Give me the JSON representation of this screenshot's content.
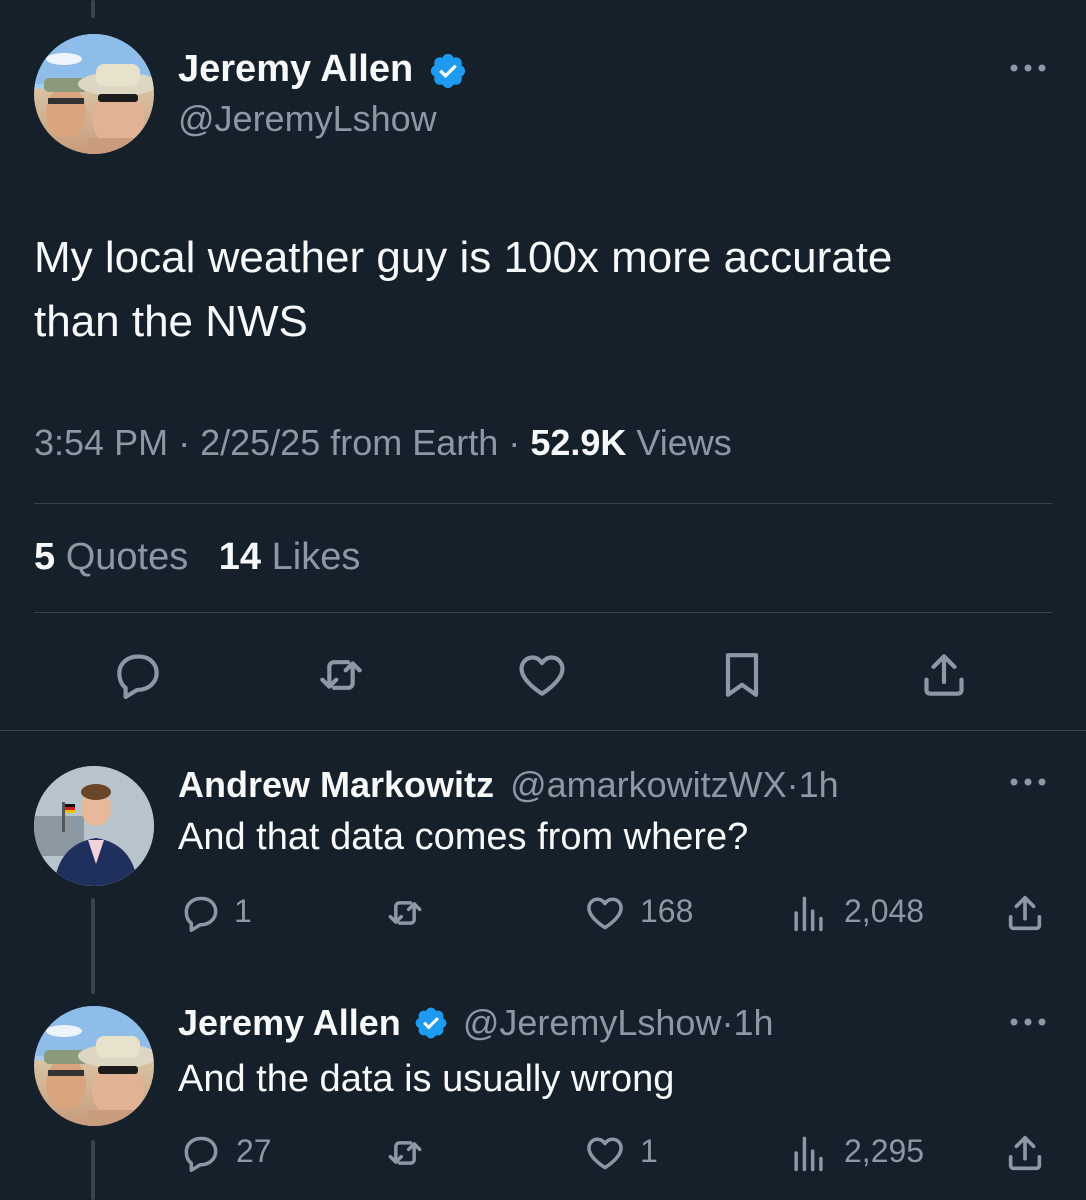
{
  "main_tweet": {
    "author_name": "Jeremy Allen",
    "handle": "@JeremyLshow",
    "text_line1": "My local weather guy is 100x more accurate",
    "text_line2": "than the NWS",
    "time": "3:54 PM",
    "date": "2/25/25 from Earth",
    "views_count": "52.9K",
    "views_label": "Views",
    "quotes_count": "5",
    "quotes_label": "Quotes",
    "likes_count": "14",
    "likes_label": "Likes"
  },
  "replies": [
    {
      "author_name": "Andrew Markowitz",
      "handle": "@amarkowitzWX",
      "time_ago": "1h",
      "text": "And that data comes from where?",
      "reply_count": "1",
      "retweet_count": "",
      "like_count": "168",
      "view_count": "2,048"
    },
    {
      "author_name": "Jeremy Allen",
      "handle": "@JeremyLshow",
      "time_ago": "1h",
      "text": "And the data is usually wrong",
      "reply_count": "27",
      "retweet_count": "",
      "like_count": "1",
      "view_count": "2,295"
    }
  ],
  "separator_dot": "·",
  "icons": {
    "verified": "verified-badge-icon",
    "more": "more-icon",
    "reply": "reply-icon",
    "retweet": "retweet-icon",
    "like": "heart-icon",
    "bookmark": "bookmark-icon",
    "share": "share-icon",
    "views": "views-icon"
  },
  "colors": {
    "background": "#15202b",
    "text": "#f7f9f9",
    "muted": "#8b98a5",
    "verified": "#1d9bf0",
    "divider": "#38444d"
  }
}
